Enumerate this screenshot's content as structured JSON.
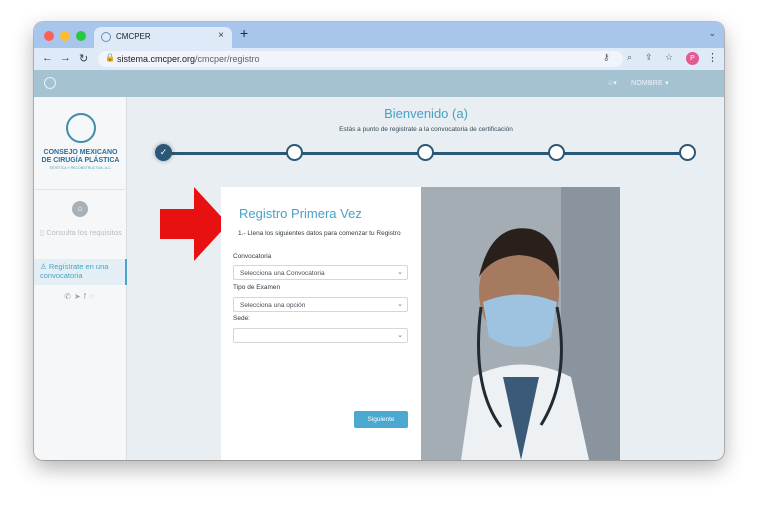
{
  "browser": {
    "tab_title": "CMCPER",
    "url_host": "sistema.cmcper.org",
    "url_path": "/cmcper/registro",
    "profile_initial": "P"
  },
  "header": {
    "user_label": "NOMBRE ▾",
    "bell": "♤▾"
  },
  "sidebar": {
    "logo_line1": "CONSEJO MEXICANO",
    "logo_line2": "DE CIRUGÍA PLÁSTICA",
    "logo_line3": "ESTÉTICA Y RECONSTRUCTIVA, A.C.",
    "items": [
      {
        "label": "Consulta los requisitos",
        "active": false
      },
      {
        "label": "Regístrate en una convocatoria",
        "active": true
      }
    ],
    "social": [
      "phone-icon",
      "telegram-icon",
      "facebook-icon",
      "whatsapp-icon"
    ]
  },
  "main": {
    "title": "Bienvenido (a)",
    "subtitle": "Estás a punto de registrate a la convocatoria de certificación",
    "steps": [
      {
        "state": "done"
      },
      {
        "state": "pending"
      },
      {
        "state": "pending"
      },
      {
        "state": "pending"
      },
      {
        "state": "pending"
      }
    ]
  },
  "form": {
    "title": "Registro Primera Vez",
    "subtitle": "1.- Llena los siguientes datos para comenzar tu Registro",
    "convocatoria_label": "Convocatoria",
    "convocatoria_value": "Selecciona una Convocatoria",
    "tipo_label": "Tipo de Examen",
    "tipo_value": "Selecciona una opción",
    "sede_label": "Sede:",
    "sede_value": "",
    "next_button": "Siguiente"
  },
  "colors": {
    "accent": "#46a2c6",
    "stepper": "#2c5878",
    "header_bar": "#a5c2d3",
    "arrow": "#e81010"
  }
}
